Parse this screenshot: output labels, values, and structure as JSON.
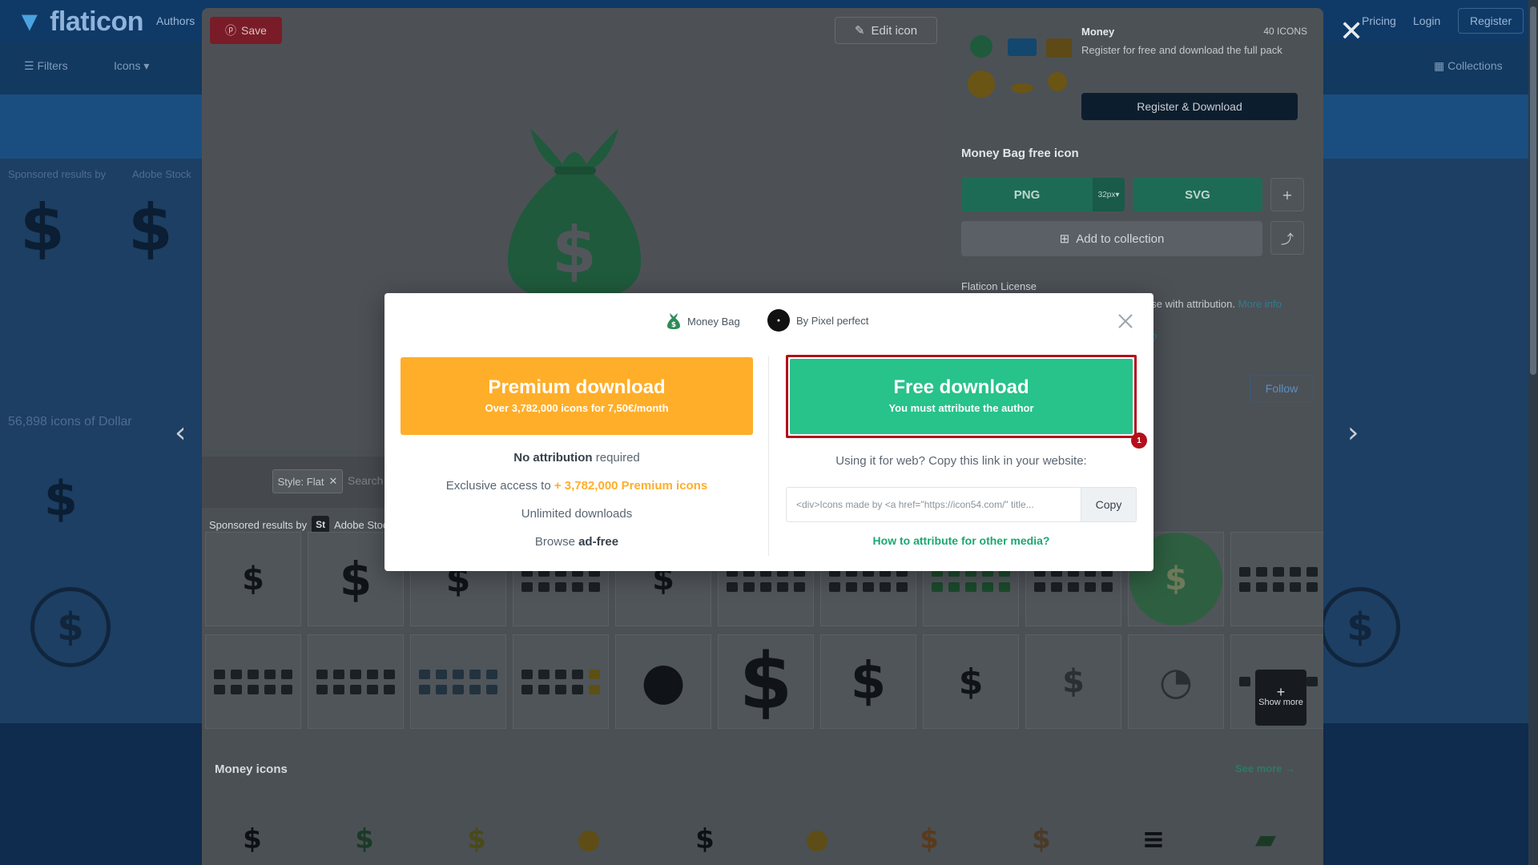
{
  "site": {
    "logo": "flaticon",
    "nav": [
      "Authors"
    ],
    "header_links": [
      "Pricing",
      "Login"
    ],
    "register": "Register",
    "subbar": [
      "Filters",
      "Icons"
    ],
    "collections": "Collections",
    "sponsored_label": "Sponsored results by",
    "adobe_stock": "Adobe Stock",
    "results_label": "56,898 icons of Dollar"
  },
  "panel": {
    "save_label": "Save",
    "edit_label": "Edit icon",
    "pack": {
      "title": "Money",
      "count": "40 ICONS",
      "description": "Register for free and download the full pack",
      "button": "Register & Download"
    },
    "free_icon_title": "Money Bag free icon",
    "png": "PNG",
    "png_size": "32px",
    "svg": "SVG",
    "add_collection": "Add to collection",
    "license_title": "Flaticon License",
    "license_text": "ose with attribution.",
    "license_more": "More info",
    "license_q": "e?",
    "follow": "Follow",
    "style_chip": "Style: Flat",
    "search_placeholder": "Search",
    "sponsored_label": "Sponsored results by",
    "adobe_stock": "Adobe Stock",
    "show_more": "Show more",
    "money_icons": "Money icons",
    "see_more": "See more"
  },
  "modal": {
    "icon_name": "Money Bag",
    "author": "By Pixel perfect",
    "premium": {
      "title": "Premium download",
      "subtitle": "Over 3,782,000 icons for 7,50€/month"
    },
    "features": {
      "no_attr_bold": "No attribution",
      "no_attr_rest": " required",
      "exclusive_pre": "Exclusive access to ",
      "exclusive_acc": "+ 3,782,000 Premium icons",
      "unlimited": "Unlimited downloads",
      "browse_pre": "Browse ",
      "browse_bold": "ad-free"
    },
    "free": {
      "title": "Free download",
      "subtitle": "You must attribute the author"
    },
    "step_badge": "1",
    "web_label": "Using it for web? Copy this link in your website:",
    "link_value": "<div>Icons made by <a href=\"https://icon54.com/\" title...",
    "copy": "Copy",
    "attr_link": "How to attribute for other media?"
  },
  "colors": {
    "premium": "#ffae29",
    "free": "#28c28b",
    "highlight": "#b3101b",
    "bag_green": "#2e8b57"
  }
}
